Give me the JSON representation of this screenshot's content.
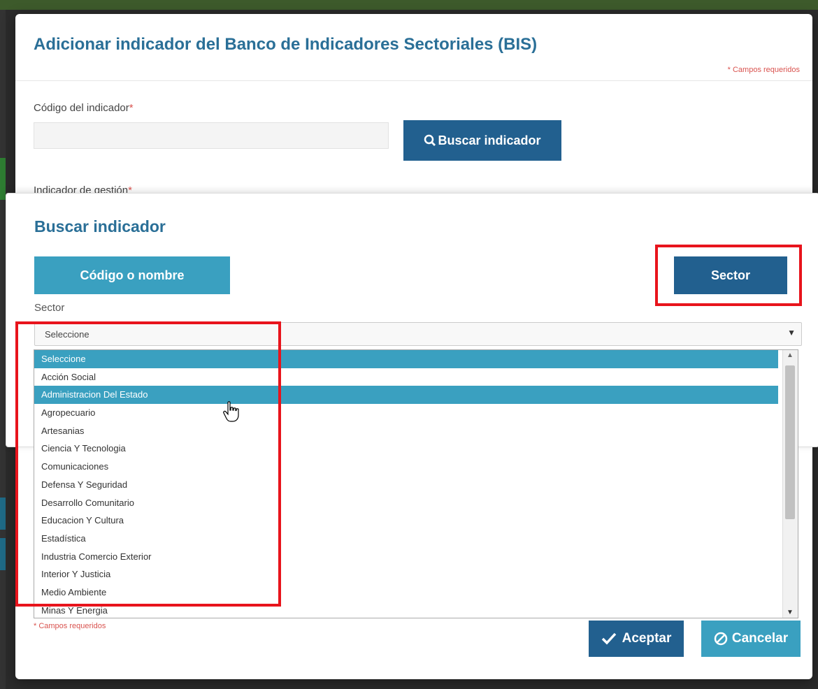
{
  "outer_dialog": {
    "title": "Adicionar indicador del Banco de Indicadores Sectoriales (BIS)",
    "required_note": "* Campos requeridos",
    "code_label": "Código del indicador",
    "code_value": "",
    "search_button": "Buscar indicador",
    "partial_label": "Indicador de gestión"
  },
  "inner_dialog": {
    "title": "Buscar indicador",
    "tab_code": "Código o nombre",
    "tab_sector": "Sector",
    "sector_label": "Sector",
    "select_value": "Seleccione"
  },
  "dropdown": {
    "items": [
      "Seleccione",
      "Acción Social",
      "Administracion Del Estado",
      "Agropecuario",
      "Artesanias",
      "Ciencia Y Tecnologia",
      "Comunicaciones",
      "Defensa Y Seguridad",
      "Desarrollo Comunitario",
      "Educacion Y Cultura",
      "Estadística",
      "Industria Comercio Exterior",
      "Interior Y Justicia",
      "Medio Ambiente",
      "Minas Y Energia"
    ],
    "selected_index": 0,
    "hovered_index": 2
  },
  "footer": {
    "required_note": "* Campos requeridos",
    "accept_label": "Aceptar",
    "cancel_label": "Cancelar"
  },
  "colors": {
    "primary": "#22608f",
    "accent": "#3aa0c0",
    "highlight_box": "#e8141c",
    "required": "#d9534f"
  }
}
